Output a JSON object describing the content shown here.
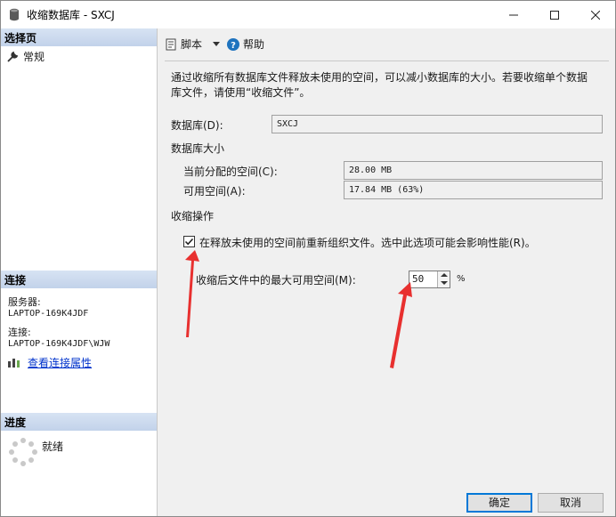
{
  "window": {
    "title": "收缩数据库 - SXCJ",
    "minimize_icon": "minimize-icon",
    "maximize_icon": "maximize-icon",
    "close_icon": "close-icon"
  },
  "left": {
    "select_page_header": "选择页",
    "nav_items": [
      {
        "label": "常规",
        "icon": "wrench-icon"
      }
    ],
    "connection_header": "连接",
    "server_label": "服务器:",
    "server_value": "LAPTOP-169K4JDF",
    "connection_label": "连接:",
    "connection_value": "LAPTOP-169K4JDF\\WJW",
    "view_connection_link": "查看连接属性",
    "progress_header": "进度",
    "progress_status": "就绪"
  },
  "toolbar": {
    "script_label": "脚本",
    "help_label": "帮助"
  },
  "main": {
    "description": "通过收缩所有数据库文件释放未使用的空间，可以减小数据库的大小。若要收缩单个数据库文件，请使用“收缩文件”。",
    "database_label": "数据库(D):",
    "database_value": "SXCJ",
    "db_size_header": "数据库大小",
    "allocated_label": "当前分配的空间(C):",
    "allocated_value": "28.00 MB",
    "free_label": "可用空间(A):",
    "free_value": "17.84 MB (63%)",
    "shrink_header": "收缩操作",
    "reorganize_label": "在释放未使用的空间前重新组织文件。选中此选项可能会影响性能(R)。",
    "reorganize_checked": true,
    "max_free_label": "收缩后文件中的最大可用空间(M):",
    "max_free_value": "50",
    "percent_unit": "%"
  },
  "footer": {
    "ok_label": "确定",
    "cancel_label": "取消"
  },
  "colors": {
    "accent": "#0078d7",
    "annotation_red": "#e8302f",
    "header_gradient": "#c2d2ea"
  }
}
